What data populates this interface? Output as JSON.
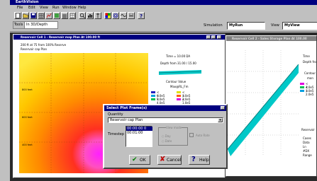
{
  "app": {
    "title": "EarthVision"
  },
  "menu": [
    "File",
    "Edit",
    "View",
    "Run",
    "Window",
    "Help"
  ],
  "toolbar": {
    "simulation_label": "Simulation",
    "simulation_value": "MyRun",
    "view_label": "View",
    "view_value": "MyView"
  },
  "tool_tabs": [
    "Tools",
    "In 3D/Depth"
  ],
  "left_window": {
    "title": "Reservoir Cell 1 - Reservoir map Plan At 100.00 ft",
    "subtitle_1": "200 ft at 75 from 100% Reserve",
    "subtitle_2": "Reservoir cap Plan",
    "time_label": "Time = 10.00 DA",
    "depth_label": "Depth from 31.00 / 15.00",
    "contour_title": "Contour Value",
    "contour_sub": "Max@RL_Fm",
    "legend": [
      {
        "label": "< 0.0e5",
        "color": "#2020c0"
      },
      {
        "label": "< 5.0e5",
        "color": "#00a0e0"
      },
      {
        "label": "< 4.0e5",
        "color": "#00c050"
      },
      {
        "label": "< 3.0e5",
        "color": "#e0e000"
      },
      {
        "label": "< 2.0e5",
        "color": "#ff6000"
      },
      {
        "label": "< 1.0e5",
        "color": "#e000e0"
      }
    ],
    "y_ticks": [
      "800 feet",
      "600 feet",
      "400 feet"
    ]
  },
  "right_window": {
    "title": "Reservoir Cell 2 - Sales Storage Plan At 100.00",
    "time_label": "Time",
    "depth_label": "Depth fro",
    "contour_title": "Contour",
    "contour_sub": "mon",
    "legend": [
      {
        "label": "< 4.0e5",
        "color": "#e000e0"
      },
      {
        "label": "< 3.0e5",
        "color": "#00c050"
      },
      {
        "label": "< 2.0e5",
        "color": "#00a0e0"
      }
    ],
    "stats_title": "Reservoir",
    "stats": [
      "Cases",
      "Data",
      "Ln",
      "#DX",
      "Range"
    ]
  },
  "dialog": {
    "title": "Select Plot Frame(s)",
    "quantity_label": "Quantity",
    "quantity_value": "Reservoir cap Plan",
    "time_list_label": "Timestep",
    "time_list": [
      "00:00:00 0",
      "00:01:00"
    ],
    "view_mode_label": "View mode",
    "radio_day": "Day",
    "radio_date": "Date",
    "auto_hint": "Auto Rate",
    "ok_label": "OK",
    "cancel_label": "Cancel",
    "help_label": "Help"
  },
  "colors": {
    "title_active": "#000080",
    "title_inactive": "#808080",
    "logo": "#f0a000"
  }
}
